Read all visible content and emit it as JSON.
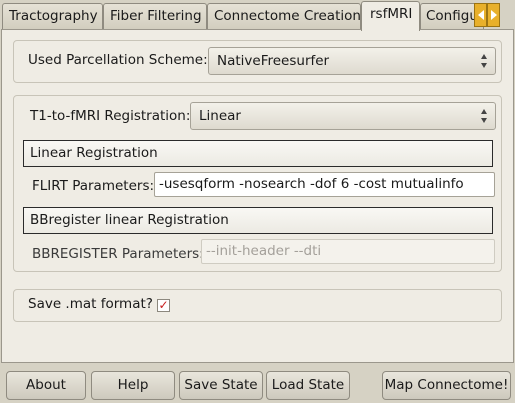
{
  "tabs": [
    {
      "label": "Tractography",
      "active": false
    },
    {
      "label": "Fiber Filtering",
      "active": false
    },
    {
      "label": "Connectome Creation",
      "active": false
    },
    {
      "label": "rsfMRI",
      "active": true
    },
    {
      "label": "Configu",
      "active": false
    }
  ],
  "parcellation": {
    "label": "Used Parcellation Scheme:",
    "value": "NativeFreesurfer"
  },
  "registration": {
    "label": "T1-to-fMRI Registration:",
    "value": "Linear",
    "linear_header": "Linear Registration",
    "flirt_label": "FLIRT Parameters:",
    "flirt_value": "-usesqform -nosearch -dof 6 -cost mutualinfo",
    "bbreg_header": "BBregister linear Registration",
    "bbreg_label": "BBREGISTER Parameters:",
    "bbreg_value": "--init-header --dti"
  },
  "save_mat": {
    "label": "Save .mat format?",
    "checked": true,
    "check_glyph": "✓"
  },
  "buttons": {
    "about": "About",
    "help": "Help",
    "save_state": "Save State",
    "load_state": "Load State",
    "map_connectome": "Map Connectome!"
  },
  "colors": {
    "tab_scroll_accent": "#e8b02b",
    "checkmark": "#c81d1d"
  }
}
